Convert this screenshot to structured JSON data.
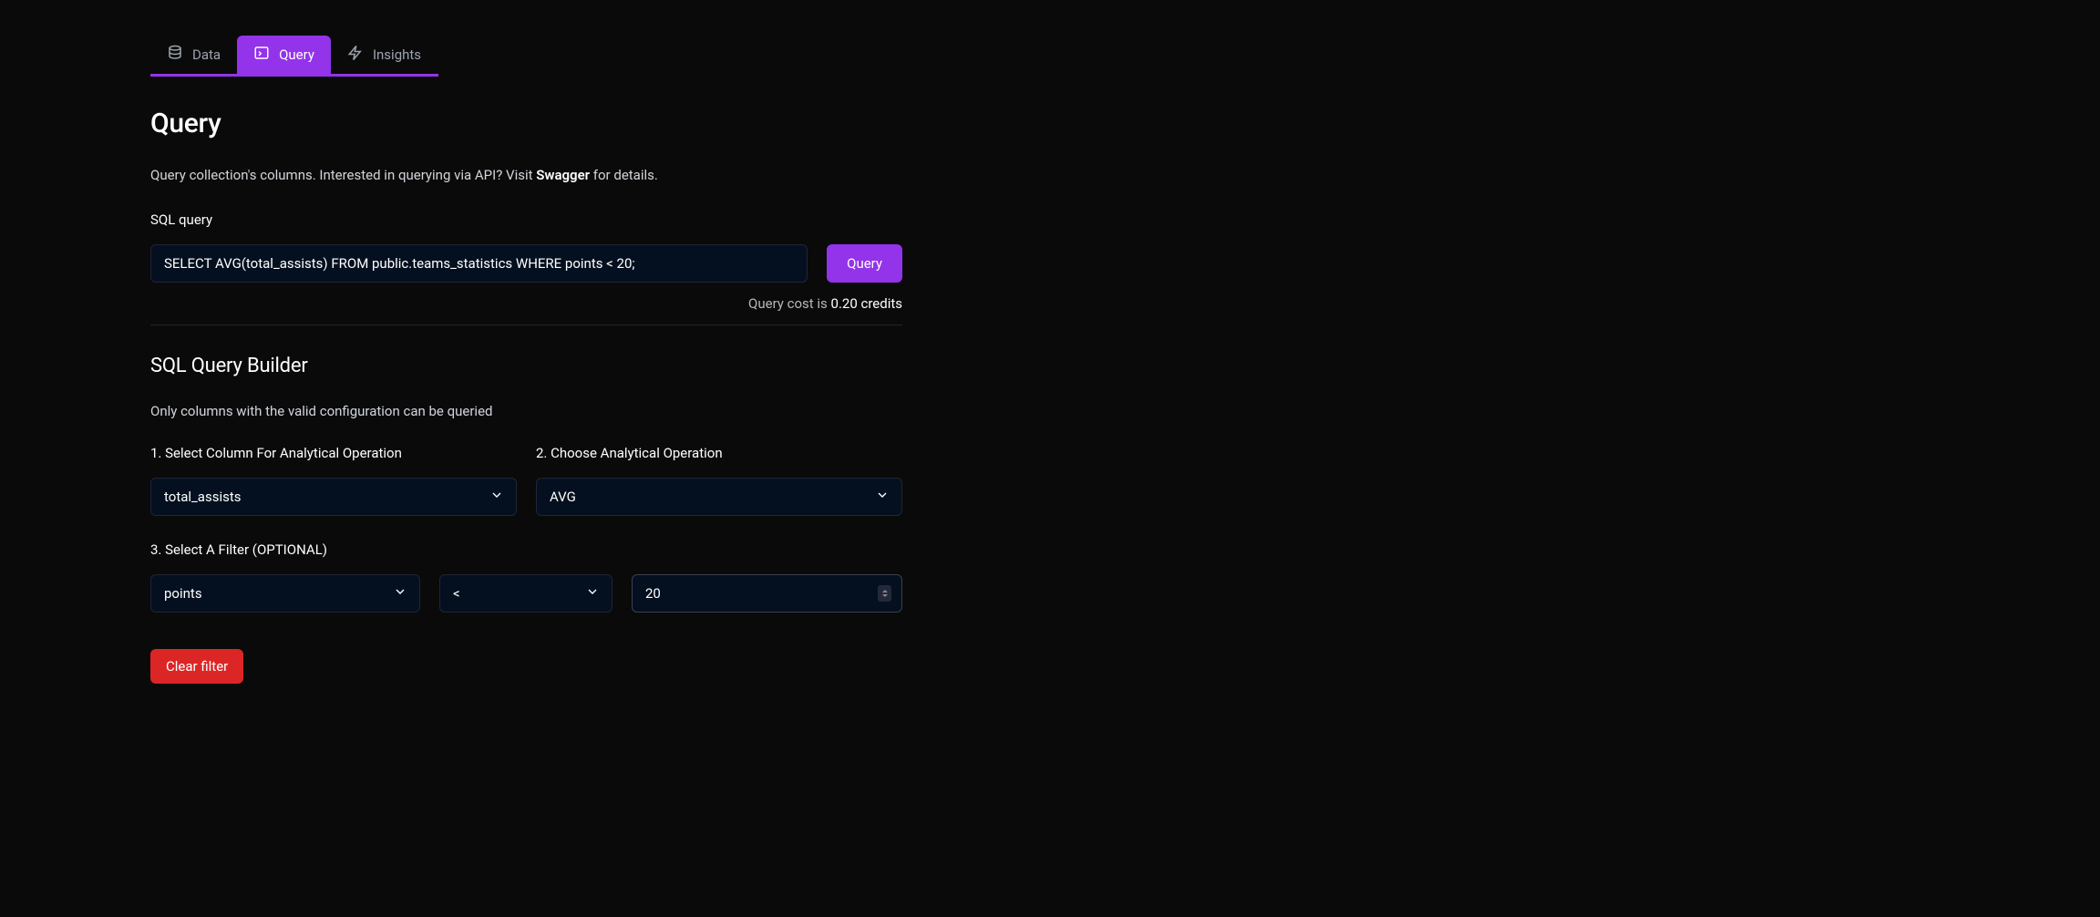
{
  "tabs": {
    "data": "Data",
    "query": "Query",
    "insights": "Insights"
  },
  "page": {
    "title": "Query",
    "description_prefix": "Query collection's columns. Interested in querying via API? Visit ",
    "swagger_link": "Swagger",
    "description_suffix": " for details."
  },
  "sql": {
    "label": "SQL query",
    "value": "SELECT AVG(total_assists) FROM public.teams_statistics WHERE points < 20;",
    "button": "Query",
    "cost_prefix": "Query cost is ",
    "cost_value": "0.20 credits"
  },
  "builder": {
    "title": "SQL Query Builder",
    "desc": "Only columns with the valid configuration can be queried",
    "step1_label": "1. Select Column For Analytical Operation",
    "step1_value": "total_assists",
    "step2_label": "2. Choose Analytical Operation",
    "step2_value": "AVG",
    "step3_label": "3. Select A Filter (OPTIONAL)",
    "filter_column": "points",
    "filter_operator": "<",
    "filter_value": "20",
    "clear_button": "Clear filter"
  }
}
